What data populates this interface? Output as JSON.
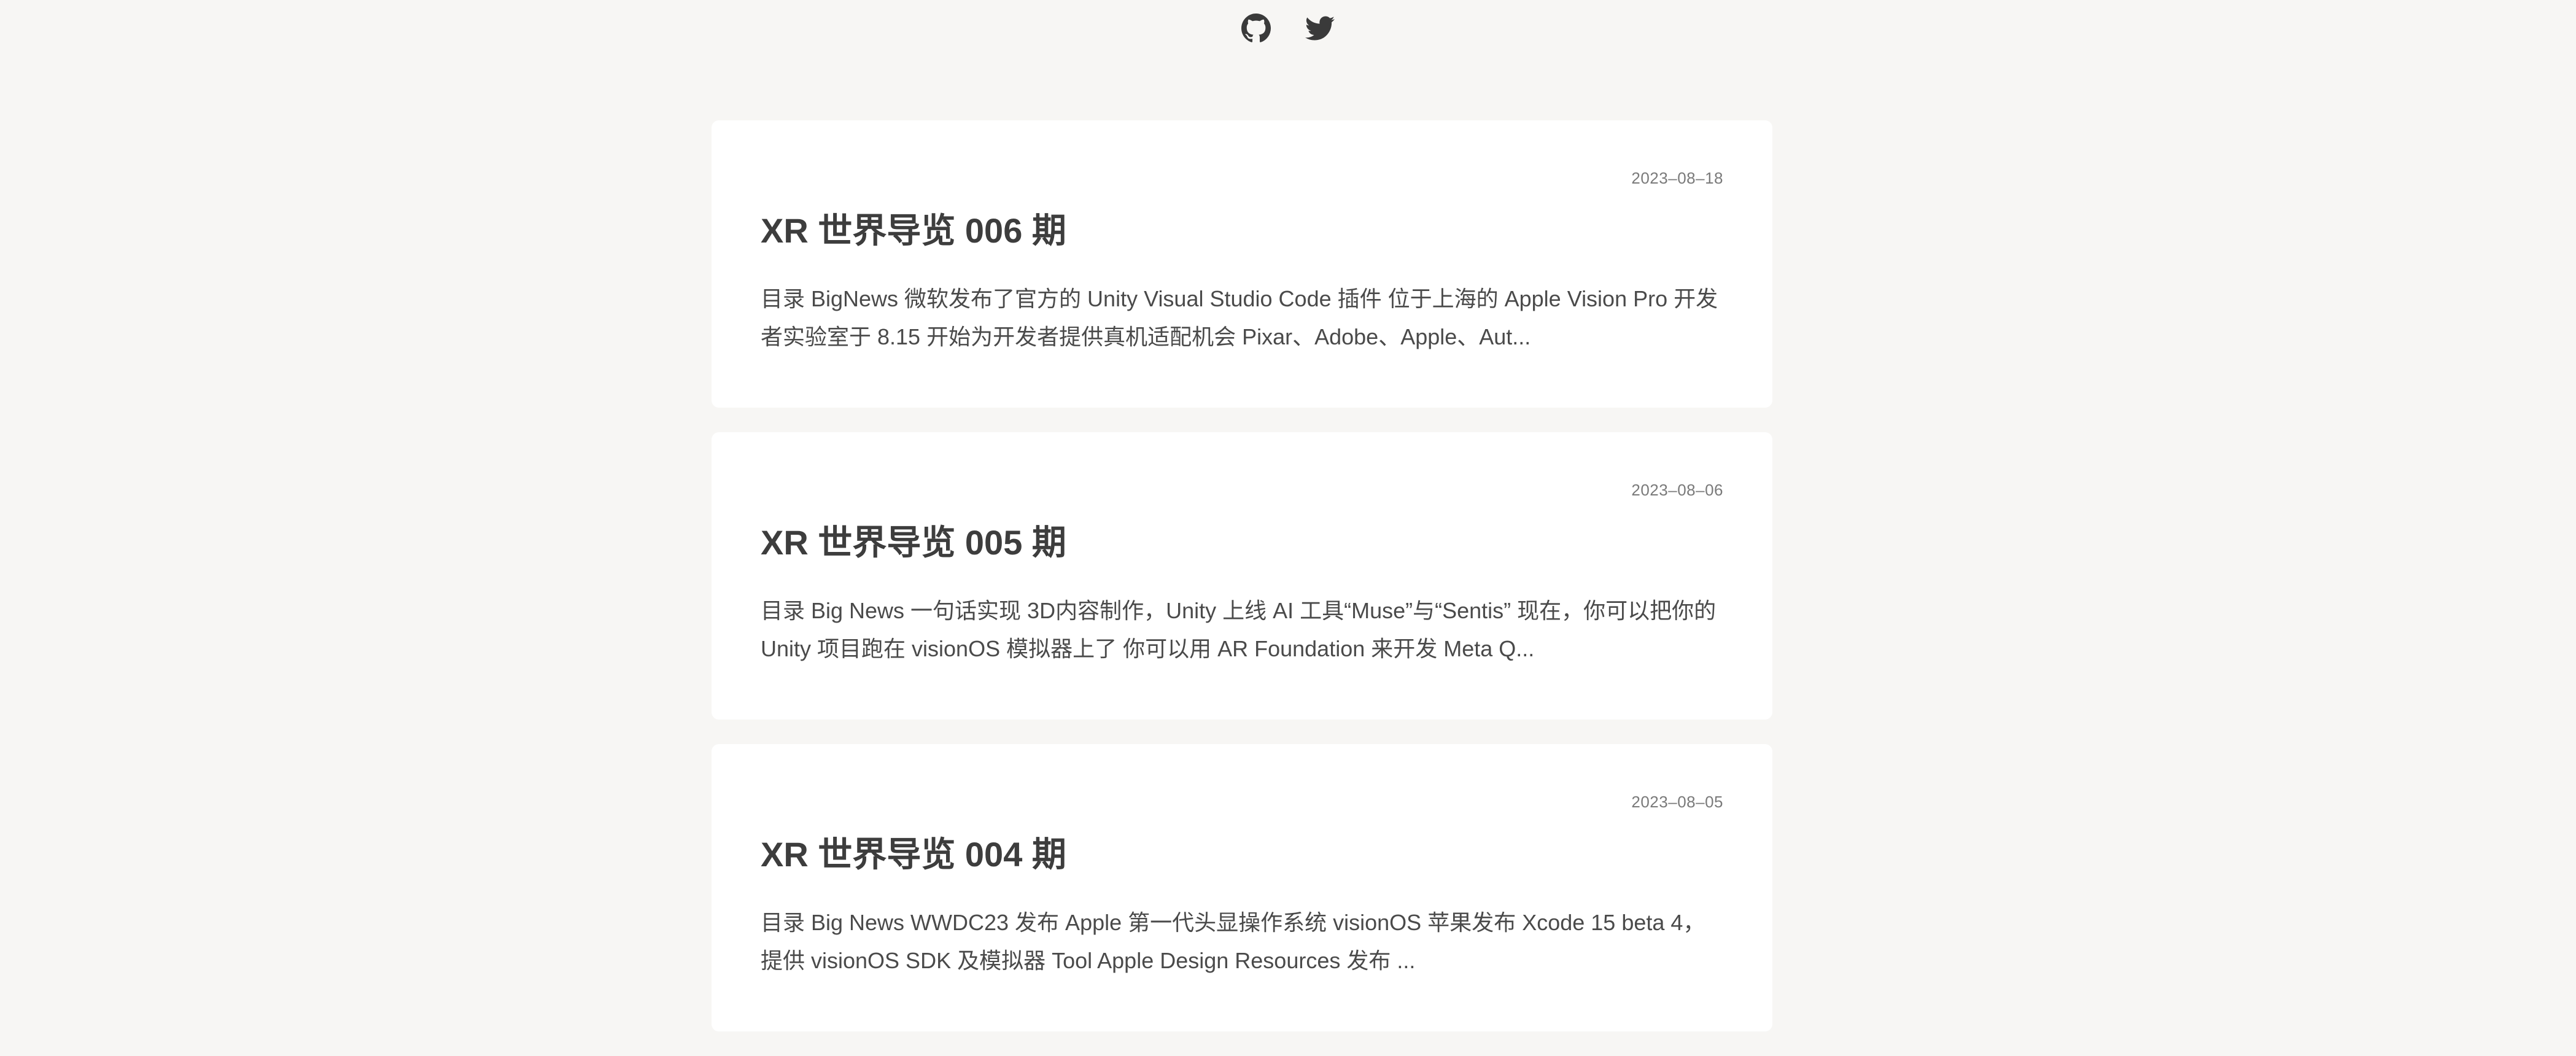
{
  "social": {
    "github_icon": "github-icon",
    "twitter_icon": "twitter-icon"
  },
  "posts": [
    {
      "date": "2023–08–18",
      "title": "XR 世界导览 006 期",
      "excerpt": "目录 BigNews 微软发布了官方的 Unity Visual Studio Code 插件 位于上海的 Apple Vision Pro 开发者实验室于 8.15 开始为开发者提供真机适配机会 Pixar、Adobe、Apple、Aut..."
    },
    {
      "date": "2023–08–06",
      "title": "XR 世界导览 005 期",
      "excerpt": "目录 Big News 一句话实现 3D内容制作，Unity 上线 AI 工具“Muse”与“Sentis” 现在，你可以把你的 Unity 项目跑在 visionOS 模拟器上了 你可以用 AR Foundation 来开发 Meta Q..."
    },
    {
      "date": "2023–08–05",
      "title": "XR 世界导览 004 期",
      "excerpt": "目录 Big News WWDC23 发布 Apple 第一代头显操作系统 visionOS 苹果发布 Xcode 15 beta 4，提供 visionOS SDK 及模拟器 Tool Apple Design Resources 发布 ..."
    }
  ],
  "colors": {
    "background": "#f7f6f4",
    "card": "#ffffff",
    "text": "#3a3a3a",
    "date": "#7a7a7a"
  }
}
